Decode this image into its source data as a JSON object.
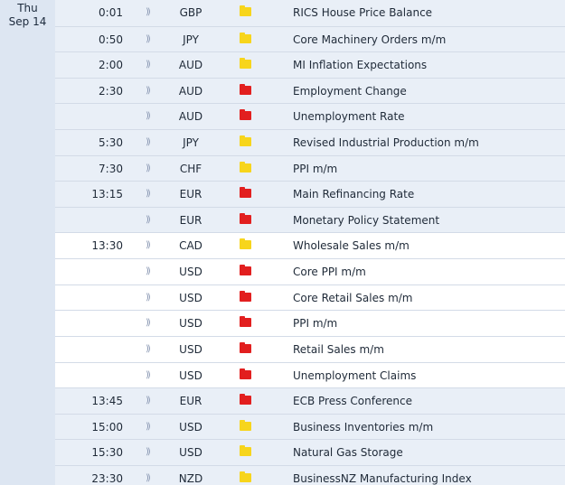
{
  "date": {
    "day": "Thu",
    "date": "Sep 14"
  },
  "impact_colors": {
    "high": "#e21f1f",
    "medium": "#f7d51c"
  },
  "rows": [
    {
      "time": "0:01",
      "currency": "GBP",
      "impact": "medium",
      "event": "RICS House Price Balance",
      "shade": true
    },
    {
      "time": "0:50",
      "currency": "JPY",
      "impact": "medium",
      "event": "Core Machinery Orders m/m",
      "shade": true
    },
    {
      "time": "2:00",
      "currency": "AUD",
      "impact": "medium",
      "event": "MI Inflation Expectations",
      "shade": true
    },
    {
      "time": "2:30",
      "currency": "AUD",
      "impact": "high",
      "event": "Employment Change",
      "shade": true
    },
    {
      "time": "",
      "currency": "AUD",
      "impact": "high",
      "event": "Unemployment Rate",
      "shade": true
    },
    {
      "time": "5:30",
      "currency": "JPY",
      "impact": "medium",
      "event": "Revised Industrial Production m/m",
      "shade": true
    },
    {
      "time": "7:30",
      "currency": "CHF",
      "impact": "medium",
      "event": "PPI m/m",
      "shade": true
    },
    {
      "time": "13:15",
      "currency": "EUR",
      "impact": "high",
      "event": "Main Refinancing Rate",
      "shade": true
    },
    {
      "time": "",
      "currency": "EUR",
      "impact": "high",
      "event": "Monetary Policy Statement",
      "shade": true
    },
    {
      "time": "13:30",
      "currency": "CAD",
      "impact": "medium",
      "event": "Wholesale Sales m/m",
      "shade": false
    },
    {
      "time": "",
      "currency": "USD",
      "impact": "high",
      "event": "Core PPI m/m",
      "shade": false
    },
    {
      "time": "",
      "currency": "USD",
      "impact": "high",
      "event": "Core Retail Sales m/m",
      "shade": false
    },
    {
      "time": "",
      "currency": "USD",
      "impact": "high",
      "event": "PPI m/m",
      "shade": false
    },
    {
      "time": "",
      "currency": "USD",
      "impact": "high",
      "event": "Retail Sales m/m",
      "shade": false
    },
    {
      "time": "",
      "currency": "USD",
      "impact": "high",
      "event": "Unemployment Claims",
      "shade": false
    },
    {
      "time": "13:45",
      "currency": "EUR",
      "impact": "high",
      "event": "ECB Press Conference",
      "shade": true
    },
    {
      "time": "15:00",
      "currency": "USD",
      "impact": "medium",
      "event": "Business Inventories m/m",
      "shade": true
    },
    {
      "time": "15:30",
      "currency": "USD",
      "impact": "medium",
      "event": "Natural Gas Storage",
      "shade": true
    },
    {
      "time": "23:30",
      "currency": "NZD",
      "impact": "medium",
      "event": "BusinessNZ Manufacturing Index",
      "shade": true
    }
  ]
}
